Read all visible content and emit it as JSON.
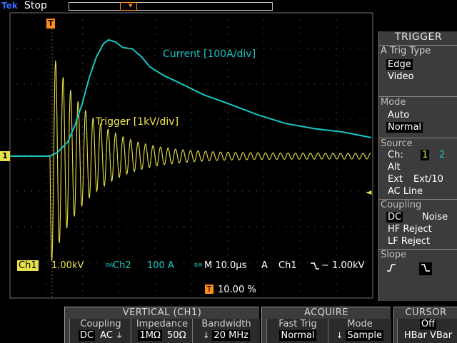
{
  "header": {
    "brand": "Tek",
    "run_status": "Stop",
    "trigger_marker": "T"
  },
  "waveform": {
    "ch1_marker": "1",
    "trigger_level_marker": "◄",
    "trace_labels": {
      "current": "Current [100A/div]",
      "trigger": "Trigger [1kV/div]"
    },
    "colors": {
      "ch1": "#e8e14a",
      "ch2": "#19c6c6",
      "grid": "#6e6e6e",
      "trigger": "#ff8c1a"
    }
  },
  "readout": {
    "ch1_label": "Ch1",
    "ch1_scale": "1.00kV",
    "ch2_label": "Ch2",
    "ch2_prefix": "BW",
    "ch2_scale": "100 A",
    "bw_marker": "BW",
    "timebase": "M 10.0µs",
    "trig_mode": "A",
    "trig_source": "Ch1",
    "trig_slope_icon": "falling-edge",
    "trig_level": "− 1.00kV",
    "trigger_position": "10.00 %"
  },
  "trigger_menu": {
    "title": "TRIGGER",
    "type": {
      "label": "A Trig Type",
      "options": [
        "Edge",
        "Video"
      ],
      "selected": "Edge"
    },
    "mode": {
      "label": "Mode",
      "options": [
        "Auto",
        "Normal"
      ],
      "selected": "Normal"
    },
    "source": {
      "label": "Source",
      "ch_label": "Ch:",
      "ch1": "1",
      "ch2": "2",
      "alt": "Alt",
      "ext": "Ext",
      "ext10": "Ext/10",
      "ac_line": "AC Line"
    },
    "coupling": {
      "label": "Coupling",
      "dc": "DC",
      "noise": "Noise",
      "hf": "HF Reject",
      "lf": "LF Reject",
      "selected": "DC"
    },
    "slope": {
      "label": "Slope",
      "rising": "rising-edge",
      "falling": "falling-edge",
      "selected": "falling"
    }
  },
  "vertical": {
    "title": "VERTICAL (CH1)",
    "coupling": {
      "label": "Coupling",
      "dc": "DC",
      "ac": "AC",
      "gnd": "gnd-icon"
    },
    "impedance": {
      "label": "Impedance",
      "one_meg": "1MΩ",
      "fifty": "50Ω"
    },
    "bandwidth": {
      "label": "Bandwidth",
      "value": "20 MHz"
    }
  },
  "acquire": {
    "title": "ACQUIRE",
    "fast_trig": {
      "label": "Fast Trig",
      "value": "Normal"
    },
    "mode": {
      "label": "Mode",
      "value": "Sample"
    }
  },
  "cursor": {
    "title": "CURSOR",
    "value": "Off",
    "options": "HBar VBar"
  }
}
